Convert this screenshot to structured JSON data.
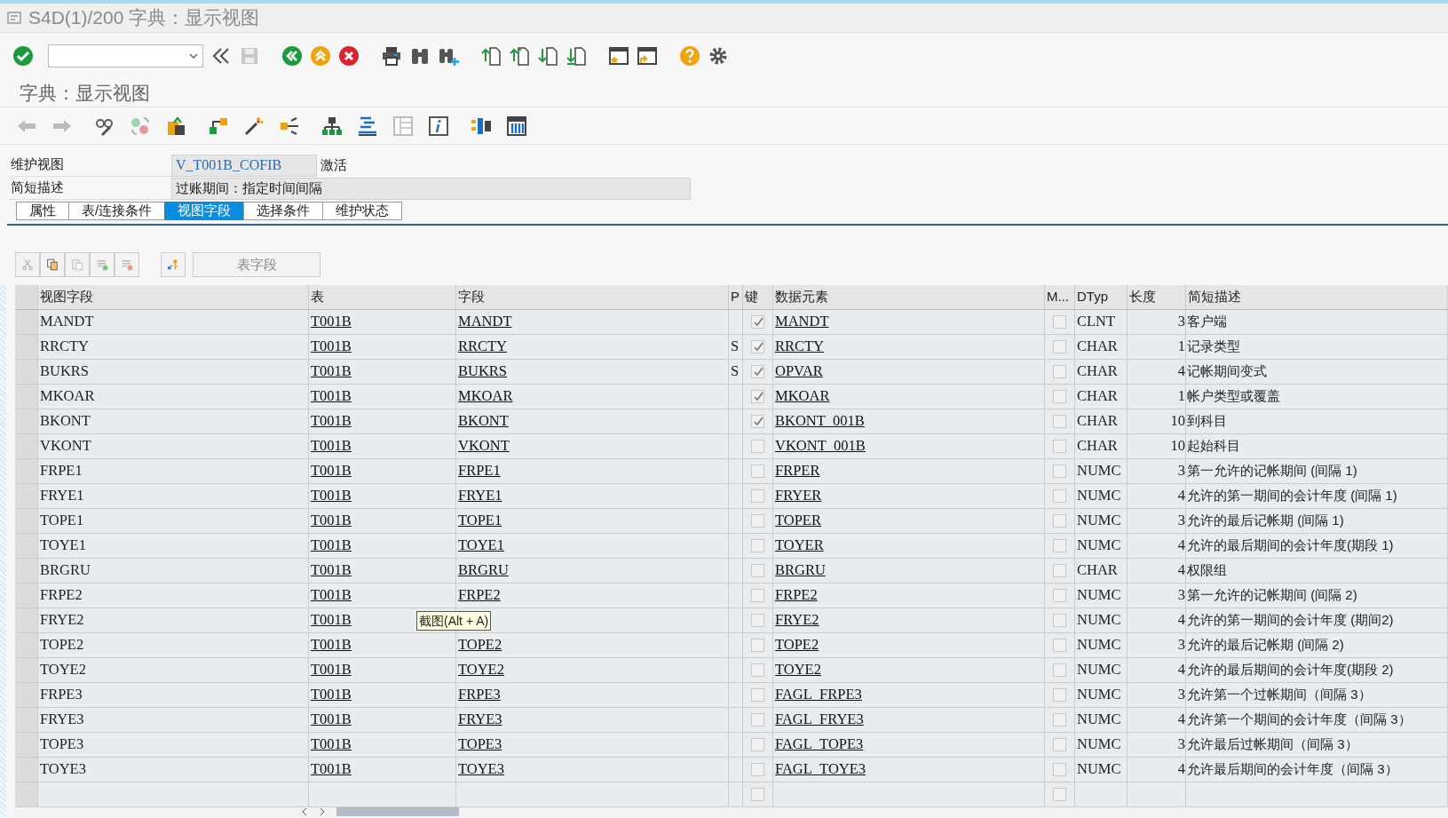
{
  "window": {
    "title": "S4D(1)/200 字典：显示视图"
  },
  "screen_title": "字典：显示视图",
  "header_fields": [
    {
      "label": "维护视图",
      "value": "V_T001B_COFIB",
      "status": "激活"
    },
    {
      "label": "简短描述",
      "value": "过账期间：指定时间间隔"
    }
  ],
  "tabs": [
    {
      "label": "属性",
      "selected": false
    },
    {
      "label": "表/连接条件",
      "selected": false
    },
    {
      "label": "视图字段",
      "selected": true
    },
    {
      "label": "选择条件",
      "selected": false
    },
    {
      "label": "维护状态",
      "selected": false
    }
  ],
  "table_toolbar": {
    "button": "表字段"
  },
  "table": {
    "columns": [
      "视图字段",
      "表",
      "字段",
      "P",
      "键",
      "数据元素",
      "M...",
      "DTyp",
      "长度",
      "简短描述"
    ],
    "rows": [
      {
        "view_field": "MANDT",
        "table": "T001B",
        "field": "MANDT",
        "key": true,
        "data_element": "MANDT",
        "m": false,
        "dtyp": "CLNT",
        "length": "3",
        "description": "客户端"
      },
      {
        "view_field": "RRCTY",
        "table": "T001B",
        "field": "RRCTY",
        "p": "S",
        "key": true,
        "data_element": "RRCTY",
        "m": false,
        "dtyp": "CHAR",
        "length": "1",
        "description": "记录类型"
      },
      {
        "view_field": "BUKRS",
        "table": "T001B",
        "field": "BUKRS",
        "p": "S",
        "key": true,
        "data_element": "OPVAR",
        "m": false,
        "dtyp": "CHAR",
        "length": "4",
        "description": "记帐期间变式"
      },
      {
        "view_field": "MKOAR",
        "table": "T001B",
        "field": "MKOAR",
        "key": true,
        "data_element": "MKOAR",
        "m": false,
        "dtyp": "CHAR",
        "length": "1",
        "description": "帐户类型或覆盖"
      },
      {
        "view_field": "BKONT",
        "table": "T001B",
        "field": "BKONT",
        "key": true,
        "data_element": "BKONT_001B",
        "m": false,
        "dtyp": "CHAR",
        "length": "10",
        "description": "到科目"
      },
      {
        "view_field": "VKONT",
        "table": "T001B",
        "field": "VKONT",
        "key": false,
        "data_element": "VKONT_001B",
        "m": false,
        "dtyp": "CHAR",
        "length": "10",
        "description": "起始科目"
      },
      {
        "view_field": "FRPE1",
        "table": "T001B",
        "field": "FRPE1",
        "key": false,
        "data_element": "FRPER",
        "m": false,
        "dtyp": "NUMC",
        "length": "3",
        "description": "第一允许的记帐期间 (间隔 1)"
      },
      {
        "view_field": "FRYE1",
        "table": "T001B",
        "field": "FRYE1",
        "key": false,
        "data_element": "FRYER",
        "m": false,
        "dtyp": "NUMC",
        "length": "4",
        "description": "允许的第一期间的会计年度 (间隔 1)"
      },
      {
        "view_field": "TOPE1",
        "table": "T001B",
        "field": "TOPE1",
        "key": false,
        "data_element": "TOPER",
        "m": false,
        "dtyp": "NUMC",
        "length": "3",
        "description": "允许的最后记帐期 (间隔 1)"
      },
      {
        "view_field": "TOYE1",
        "table": "T001B",
        "field": "TOYE1",
        "key": false,
        "data_element": "TOYER",
        "m": false,
        "dtyp": "NUMC",
        "length": "4",
        "description": "允许的最后期间的会计年度(期段 1)"
      },
      {
        "view_field": "BRGRU",
        "table": "T001B",
        "field": "BRGRU",
        "key": false,
        "data_element": "BRGRU",
        "m": false,
        "dtyp": "CHAR",
        "length": "4",
        "description": "权限组"
      },
      {
        "view_field": "FRPE2",
        "table": "T001B",
        "field": "FRPE2",
        "key": false,
        "data_element": "FRPE2",
        "m": false,
        "dtyp": "NUMC",
        "length": "3",
        "description": "第一允许的记帐期间 (间隔 2)"
      },
      {
        "view_field": "FRYE2",
        "table": "T001B",
        "tooltip": "截图(Alt + A)",
        "key": false,
        "data_element": "FRYE2",
        "m": false,
        "dtyp": "NUMC",
        "length": "4",
        "description": "允许的第一期间的会计年度 (期间2)"
      },
      {
        "view_field": "TOPE2",
        "table": "T001B",
        "field": "TOPE2",
        "key": false,
        "data_element": "TOPE2",
        "m": false,
        "dtyp": "NUMC",
        "length": "3",
        "description": "允许的最后记帐期 (间隔 2)"
      },
      {
        "view_field": "TOYE2",
        "table": "T001B",
        "field": "TOYE2",
        "key": false,
        "data_element": "TOYE2",
        "m": false,
        "dtyp": "NUMC",
        "length": "4",
        "description": "允许的最后期间的会计年度(期段 2)"
      },
      {
        "view_field": "FRPE3",
        "table": "T001B",
        "field": "FRPE3",
        "key": false,
        "data_element": "FAGL_FRPE3",
        "m": false,
        "dtyp": "NUMC",
        "length": "3",
        "description": "允许第一个过帐期间（间隔 3）"
      },
      {
        "view_field": "FRYE3",
        "table": "T001B",
        "field": "FRYE3",
        "key": false,
        "data_element": "FAGL_FRYE3",
        "m": false,
        "dtyp": "NUMC",
        "length": "4",
        "description": "允许第一个期间的会计年度（间隔 3）"
      },
      {
        "view_field": "TOPE3",
        "table": "T001B",
        "field": "TOPE3",
        "key": false,
        "data_element": "FAGL_TOPE3",
        "m": false,
        "dtyp": "NUMC",
        "length": "3",
        "description": "允许最后过帐期间（间隔 3）"
      },
      {
        "view_field": "TOYE3",
        "table": "T001B",
        "field": "TOYE3",
        "key": false,
        "data_element": "FAGL_TOYE3",
        "m": false,
        "dtyp": "NUMC",
        "length": "4",
        "description": "允许最后期间的会计年度（间隔 3）"
      },
      {
        "key": false,
        "m": false
      }
    ]
  }
}
